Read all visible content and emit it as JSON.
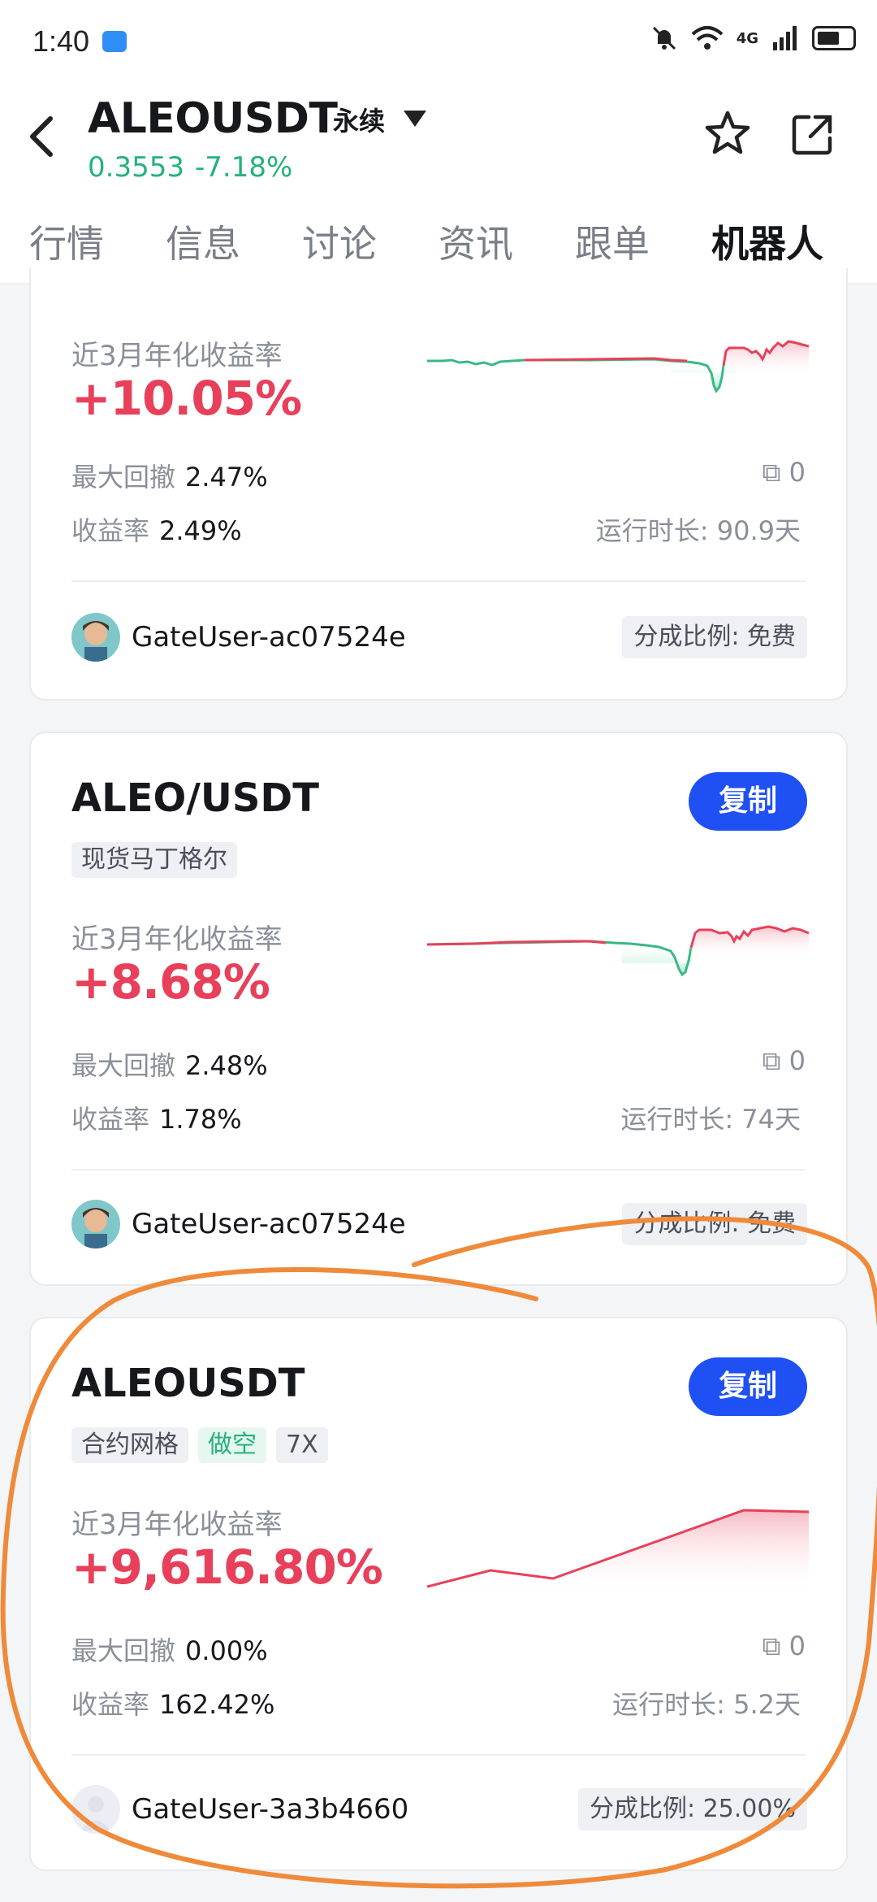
{
  "status": {
    "time": "1:40",
    "network": "4G"
  },
  "header": {
    "symbol": "ALEOUSDT",
    "contract_type": "永续",
    "price": "0.3553",
    "change": "-7.18%"
  },
  "tabs": [
    "行情",
    "信息",
    "讨论",
    "资讯",
    "跟单",
    "机器人"
  ],
  "active_tab": "机器人",
  "colors": {
    "accent": "#1f50f3",
    "profit": "#e8405a",
    "up": "#24b27a",
    "circle": "#ef8a3a"
  },
  "cards": [
    {
      "annual_label": "近3月年化收益率",
      "annual_value": "+10.05%",
      "drawdown_label": "最大回撤",
      "drawdown_value": "2.47%",
      "return_label": "收益率",
      "return_value": "2.49%",
      "copies": "0",
      "runtime": "运行时长: 90.9天",
      "user": "GateUser-ac07524e",
      "share_ratio": "分成比例: 免费"
    },
    {
      "title": "ALEO/USDT",
      "copy_label": "复制",
      "tags": [
        "现货马丁格尔"
      ],
      "annual_label": "近3月年化收益率",
      "annual_value": "+8.68%",
      "drawdown_label": "最大回撤",
      "drawdown_value": "2.48%",
      "return_label": "收益率",
      "return_value": "1.78%",
      "copies": "0",
      "runtime": "运行时长: 74天",
      "user": "GateUser-ac07524e",
      "share_ratio": "分成比例: 免费"
    },
    {
      "title": "ALEOUSDT",
      "copy_label": "复制",
      "tags": [
        "合约网格",
        "做空",
        "7X"
      ],
      "annual_label": "近3月年化收益率",
      "annual_value": "+9,616.80%",
      "drawdown_label": "最大回撤",
      "drawdown_value": "0.00%",
      "return_label": "收益率",
      "return_value": "162.42%",
      "copies": "0",
      "runtime": "运行时长: 5.2天",
      "user": "GateUser-3a3b4660",
      "share_ratio": "分成比例: 25.00%"
    }
  ]
}
